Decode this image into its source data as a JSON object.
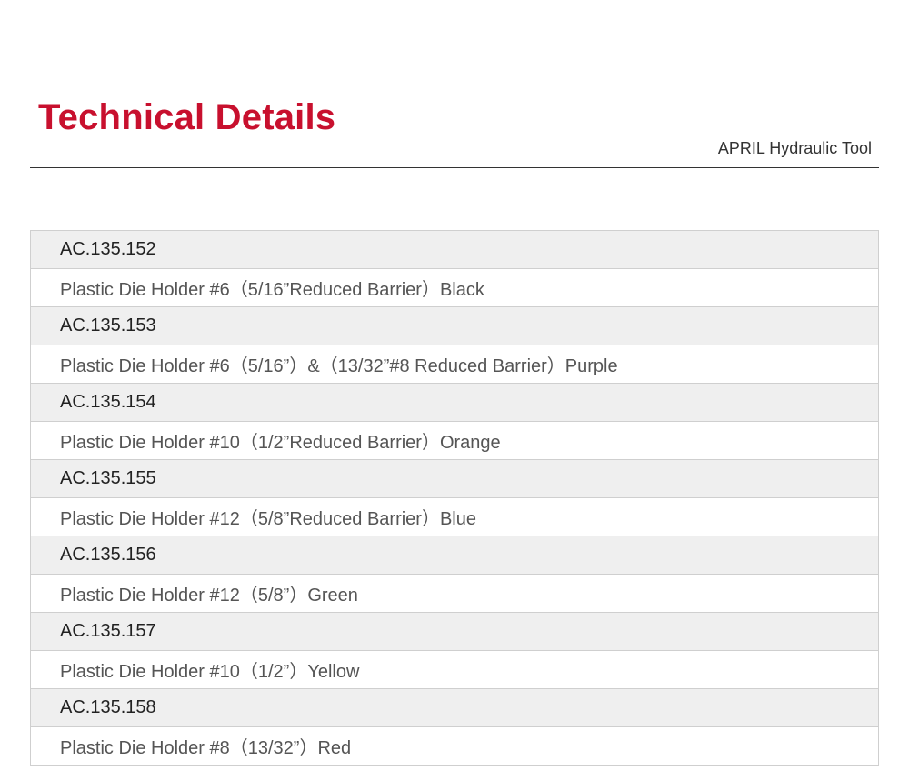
{
  "header": {
    "title": "Technical Details",
    "subtitle": "APRIL Hydraulic Tool"
  },
  "colors": {
    "title": "#c8102e",
    "code_row_bg": "#efefef",
    "desc_row_bg": "#ffffff",
    "border": "#cfcfcf"
  },
  "items": [
    {
      "code": "AC.135.152",
      "description": "Plastic Die Holder #6（5/16”Reduced Barrier）Black"
    },
    {
      "code": "AC.135.153",
      "description": "Plastic Die Holder #6（5/16”）&（13/32”#8 Reduced Barrier）Purple"
    },
    {
      "code": "AC.135.154",
      "description": "Plastic Die Holder #10（1/2”Reduced Barrier）Orange"
    },
    {
      "code": "AC.135.155",
      "description": "Plastic Die Holder #12（5/8”Reduced Barrier）Blue"
    },
    {
      "code": "AC.135.156",
      "description": "Plastic Die Holder #12（5/8”）Green"
    },
    {
      "code": "AC.135.157",
      "description": "Plastic Die Holder #10（1/2”）Yellow"
    },
    {
      "code": "AC.135.158",
      "description": "Plastic Die Holder #8（13/32”）Red"
    }
  ]
}
